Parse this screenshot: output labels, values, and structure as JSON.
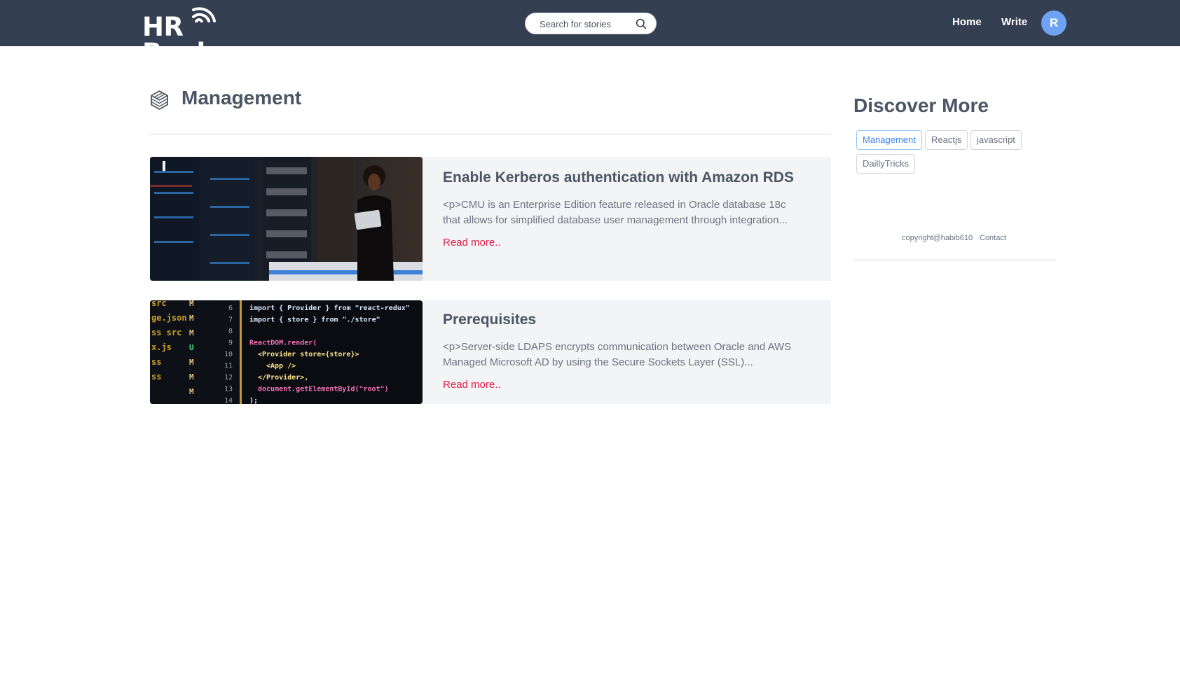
{
  "header": {
    "logo_text": "HR Books",
    "search": {
      "placeholder": "Search for stories",
      "value": ""
    },
    "nav": {
      "home": "Home",
      "write": "Write"
    },
    "avatar_initial": "R",
    "colors": {
      "background": "#353f52",
      "avatar": "#6ea2f3"
    }
  },
  "main": {
    "category_title": "Management",
    "posts": [
      {
        "title": "Enable Kerberos authentication with Amazon RDS",
        "excerpt": "<p>CMU is an Enterprise Edition feature released in Oracle database 18c that allows for simplified database user management through integration...",
        "read_more": "Read more..",
        "image": "woman-with-laptop-in-server-room"
      },
      {
        "title": "Prerequisites",
        "excerpt": "<p>Server-side LDAPS encrypts communication between Oracle and AWS Managed Microsoft AD by using the Secure Sockets Layer (SSL)...",
        "read_more": "Read more..",
        "image": "code-editor-screenshot"
      }
    ],
    "code_lines": [
      {
        "num": "6",
        "text": "import { Provider } from \"react-redux\""
      },
      {
        "num": "7",
        "text": "import { store } from \"./store\""
      },
      {
        "num": "8",
        "text": ""
      },
      {
        "num": "9",
        "text": "ReactDOM.render("
      },
      {
        "num": "10",
        "text": "<Provider store={store}>"
      },
      {
        "num": "11",
        "text": "<App />"
      },
      {
        "num": "12",
        "text": "</Provider>,"
      },
      {
        "num": "13",
        "text": "document.getElementById(\"root\")"
      },
      {
        "num": "14",
        "text": ");"
      }
    ],
    "code_files": [
      {
        "name": "src",
        "status": "M"
      },
      {
        "name": "ge.json",
        "status": "M"
      },
      {
        "name": "ss src",
        "status": "M"
      },
      {
        "name": "x.js",
        "status": "U"
      },
      {
        "name": "ss",
        "status": "M"
      },
      {
        "name": "ss",
        "status": "M"
      },
      {
        "name": "",
        "status": "M"
      }
    ]
  },
  "sidebar": {
    "title": "Discover More",
    "tags": [
      {
        "label": "Management",
        "active": true
      },
      {
        "label": "Reactjs",
        "active": false
      },
      {
        "label": "javascript",
        "active": false
      },
      {
        "label": "DaillyTricks",
        "active": false
      }
    ],
    "footer": {
      "copyright": "copyright@habib610",
      "contact": "Contact"
    }
  },
  "colors": {
    "accent_link": "#e11d48",
    "tag_active": "#3b82f6",
    "card_background": "#f3f4f6",
    "text": "#4b5563"
  }
}
